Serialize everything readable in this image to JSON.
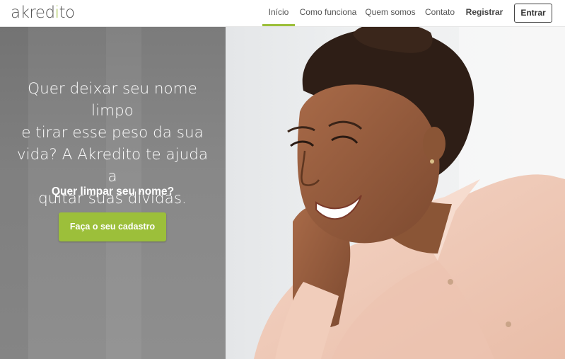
{
  "logo": {
    "prefix": "akred",
    "accent": "i",
    "suffix": "to"
  },
  "nav": {
    "items": [
      {
        "label": "Início",
        "active": true
      },
      {
        "label": "Como funciona"
      },
      {
        "label": "Quem somos"
      },
      {
        "label": "Contato"
      },
      {
        "label": "Registrar"
      }
    ],
    "login_label": "Entrar"
  },
  "hero": {
    "headline_lines": [
      "Quer deixar seu nome limpo",
      "e tirar esse peso da sua",
      "vida? A Akredito te ajuda a",
      "quitar suas dívidas."
    ],
    "subheadline": "Quer limpar seu nome?",
    "cta_label": "Faça o seu cadastro"
  },
  "colors": {
    "accent": "#9cbf3a",
    "hero_panel": "#888888",
    "text_dark": "#444444"
  }
}
